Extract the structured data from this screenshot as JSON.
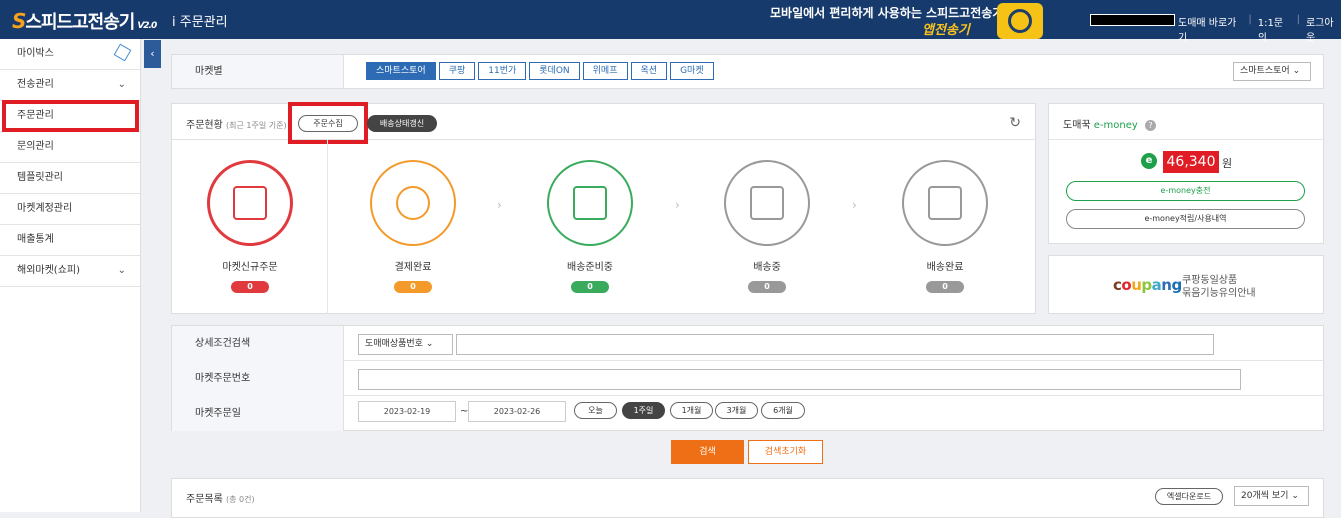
{
  "header": {
    "logo_s": "S",
    "logo_text": "스피드고전송기",
    "logo_version": "V2.0",
    "page_title": "i 주문관리",
    "promo_line": "모바일에서 편리하게 사용하는 스피드고전송기!",
    "promo_brand": "앱전송기",
    "links": [
      "도매매 바로가기",
      "1:1문의",
      "로그아웃"
    ]
  },
  "sidebar": {
    "items": [
      {
        "label": "마이박스",
        "icon": "cube-icon"
      },
      {
        "label": "전송관리",
        "icon": "chevron-down-icon"
      },
      {
        "label": "주문관리",
        "active": true
      },
      {
        "label": "문의관리"
      },
      {
        "label": "템플릿관리"
      },
      {
        "label": "마켓계정관리"
      },
      {
        "label": "매출통계"
      },
      {
        "label": "해외마켓(쇼피)",
        "icon": "chevron-down-icon"
      }
    ],
    "collapse_glyph": "‹"
  },
  "market": {
    "label": "마켓별",
    "tabs": [
      "스마트스토어",
      "쿠팡",
      "11번가",
      "롯데ON",
      "위메프",
      "옥션",
      "G마켓"
    ],
    "selected_tab": "스마트스토어",
    "select_value": "스마트스토어"
  },
  "orders": {
    "title": "주문현황",
    "subtitle": "(최근 1주일 기준)",
    "collect_button": "주문수집",
    "refresh_button": "배송상태갱신",
    "stages": [
      {
        "label": "마켓신규주문",
        "count": "0",
        "color": "#e03a3e"
      },
      {
        "label": "결제완료",
        "count": "0",
        "color": "#f39a2b"
      },
      {
        "label": "배송준비중",
        "count": "0",
        "color": "#3aab5c"
      },
      {
        "label": "배송중",
        "count": "0",
        "color": "#999999"
      },
      {
        "label": "배송완료",
        "count": "0",
        "color": "#999999"
      }
    ]
  },
  "emoney": {
    "title_prefix": "도매꾹",
    "title_suffix": "e-money",
    "help": "?",
    "icon_letter": "e",
    "amount": "46,340",
    "unit": "원",
    "charge_button": "e-money충전",
    "history_button": "e-money적립/사용내역"
  },
  "coupang": {
    "logo": "coupang",
    "line1": "쿠팡동일상품",
    "line2": "묶음기능유의안내"
  },
  "search": {
    "detail_label": "상세조건검색",
    "detail_select": "도매매상품번호",
    "order_no_label": "마켓주문번호",
    "date_label": "마켓주문일",
    "date_from": "2023-02-19",
    "date_to": "2023-02-26",
    "date_dash": "~",
    "ranges": [
      "오늘",
      "1주일",
      "1개월",
      "3개월",
      "6개월"
    ],
    "selected_range": "1주일",
    "search_button": "검색",
    "reset_button": "검색초기화"
  },
  "list": {
    "title": "주문목록",
    "count": "(총 0건)",
    "excel_button": "엑셀다운로드",
    "page_size": "20개씩 보기"
  },
  "colors": {
    "header_bg": "#173a6c",
    "accent_blue": "#2d6cb5",
    "highlight_red": "#e01c24",
    "emoney_green": "#1ea04a",
    "search_orange": "#ee6f15"
  }
}
